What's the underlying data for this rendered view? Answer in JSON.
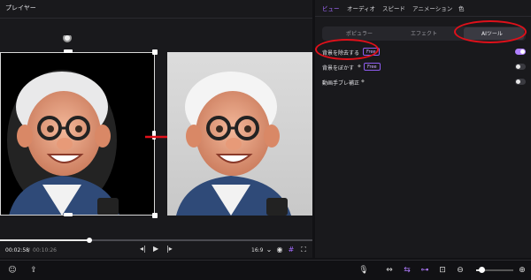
{
  "player": {
    "title": "プレイヤー",
    "time_current": "00:02:58",
    "time_separator": "/",
    "time_total": "00:10:26",
    "progress": 0.285,
    "aspect_ratio": "16:9"
  },
  "right_panel": {
    "tabs": [
      {
        "label": "ビュー",
        "active": true
      },
      {
        "label": "オーディオ",
        "active": false
      },
      {
        "label": "スピード",
        "active": false
      },
      {
        "label": "アニメーション",
        "active": false
      },
      {
        "label": "色",
        "active": false
      }
    ],
    "subtabs": [
      {
        "label": "ポピュラー",
        "active": false
      },
      {
        "label": "エフェクト",
        "active": false
      },
      {
        "label": "AIツール",
        "active": true
      }
    ],
    "options": [
      {
        "label": "背景を除去する",
        "star": "",
        "badge": "Free",
        "enabled": true
      },
      {
        "label": "背景をぼかす",
        "star": "◆",
        "badge": "Free",
        "enabled": false
      },
      {
        "label": "動画手ブレ補正",
        "star": "◆",
        "badge": "",
        "enabled": false
      }
    ]
  },
  "bottom_bar": {
    "zoom_level": 0.15
  },
  "colors": {
    "accent": "#a46bff",
    "annotation": "#e0101a"
  }
}
